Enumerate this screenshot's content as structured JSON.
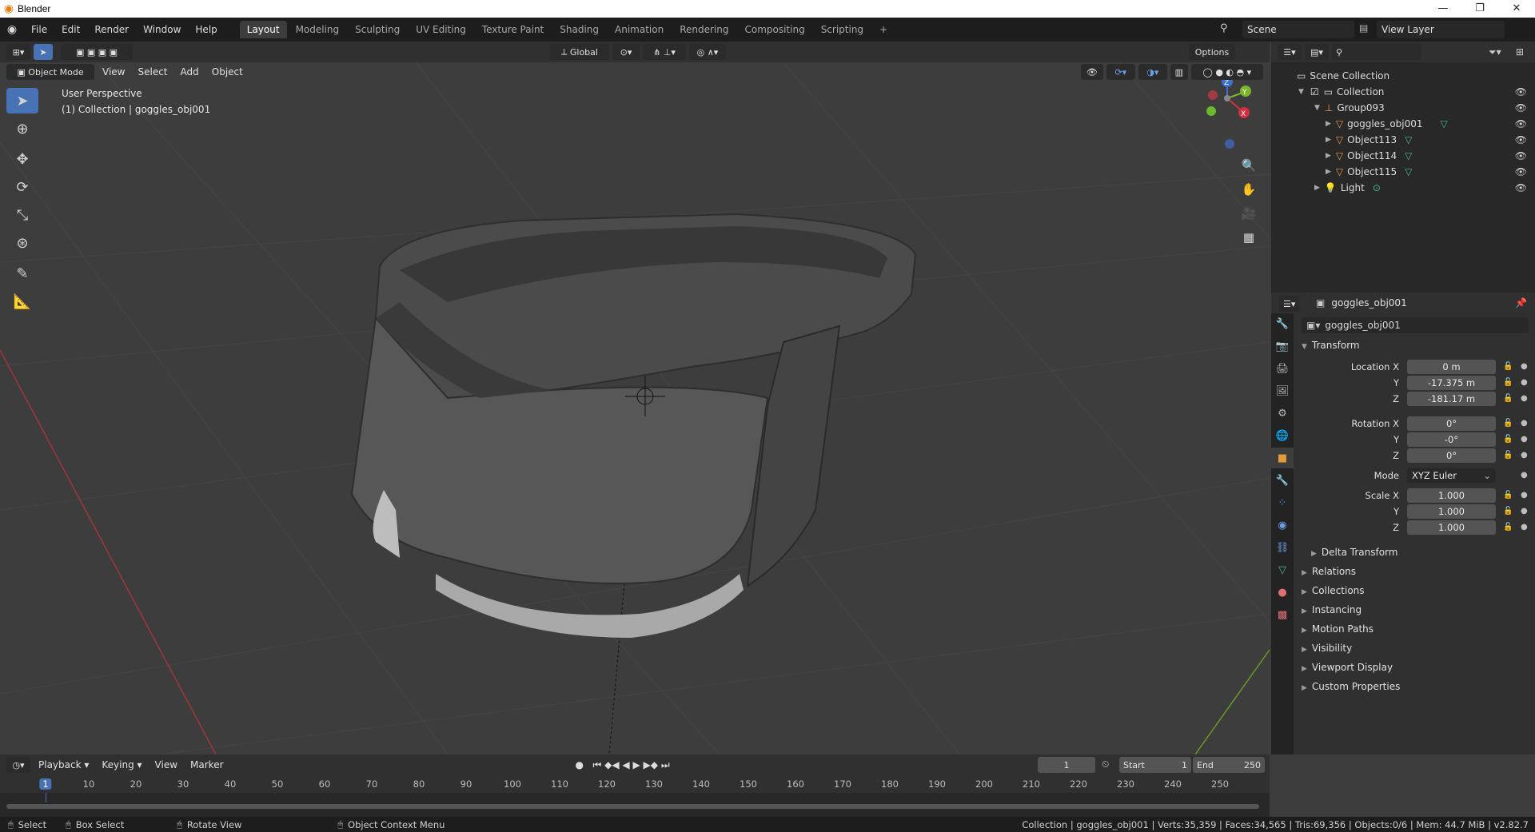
{
  "window": {
    "title": "Blender",
    "controls": [
      "—",
      "❐",
      "✕"
    ]
  },
  "menubar": {
    "items": [
      "File",
      "Edit",
      "Render",
      "Window",
      "Help"
    ],
    "workspaces": [
      "Layout",
      "Modeling",
      "Sculpting",
      "UV Editing",
      "Texture Paint",
      "Shading",
      "Animation",
      "Rendering",
      "Compositing",
      "Scripting"
    ],
    "add_tab": "+",
    "scene": "Scene",
    "view_layer": "View Layer"
  },
  "viewport_header": {
    "orientation": "Global",
    "options": "Options",
    "mode": "Object Mode",
    "menus": [
      "View",
      "Select",
      "Add",
      "Object"
    ]
  },
  "viewport": {
    "perspective": "User Perspective",
    "context": "(1) Collection | goggles_obj001",
    "gizmo": {
      "z": "Z",
      "y": "Y",
      "x": "X"
    }
  },
  "outliner": {
    "rows": [
      {
        "label": "Scene Collection"
      },
      {
        "label": "Collection"
      },
      {
        "label": "Group093"
      },
      {
        "label": "goggles_obj001"
      },
      {
        "label": "Object113"
      },
      {
        "label": "Object114"
      },
      {
        "label": "Object115"
      },
      {
        "label": "Light"
      }
    ]
  },
  "properties": {
    "object_name": "goggles_obj001",
    "datablock": "goggles_obj001",
    "transform_title": "Transform",
    "location_label": "Location X",
    "rotation_label": "Rotation X",
    "scale_label": "Scale X",
    "y_label": "Y",
    "z_label": "Z",
    "location": [
      "0 m",
      "-17.375 m",
      "-181.17 m"
    ],
    "rotation": [
      "0°",
      "-0°",
      "0°"
    ],
    "mode_label": "Mode",
    "mode_value": "XYZ Euler",
    "scale": [
      "1.000",
      "1.000",
      "1.000"
    ],
    "delta": "Delta Transform",
    "panels": [
      "Relations",
      "Collections",
      "Instancing",
      "Motion Paths",
      "Visibility",
      "Viewport Display",
      "Custom Properties"
    ]
  },
  "timeline": {
    "menus": [
      "Playback",
      "Keying",
      "View",
      "Marker"
    ],
    "current_frame": "1",
    "start_label": "Start",
    "start": "1",
    "end_label": "End",
    "end": "250",
    "ticks": [
      "1",
      "10",
      "20",
      "30",
      "40",
      "50",
      "60",
      "70",
      "80",
      "90",
      "100",
      "110",
      "120",
      "130",
      "140",
      "150",
      "160",
      "170",
      "180",
      "190",
      "200",
      "210",
      "220",
      "230",
      "240",
      "250"
    ]
  },
  "statusbar": {
    "select": "Select",
    "box_select": "Box Select",
    "rotate_view": "Rotate View",
    "context_menu": "Object Context Menu",
    "stats": "Collection | goggles_obj001 | Verts:35,359 | Faces:34,565 | Tris:69,356 | Objects:0/6 | Mem: 44.7 MiB | v2.82.7"
  }
}
